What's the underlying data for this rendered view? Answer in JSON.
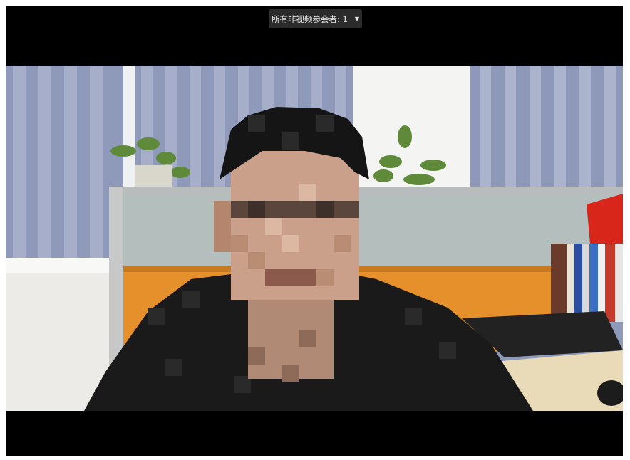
{
  "meeting": {
    "non_video_participants_label": "所有非视频参会者: 1",
    "dropdown_icon": "caret-down-icon"
  },
  "video": {
    "content": "pixelated-face-participant-feed",
    "background_colors": {
      "blinds": "#8b94b6",
      "window_light": "#f2f2f0",
      "cabinet_orange": "#e8922a",
      "glass_partition": "#aeb6b6",
      "shirt": "#1a1a1a",
      "hair": "#141414",
      "skin": "#c99a80",
      "desk": "#eadbb8"
    }
  }
}
